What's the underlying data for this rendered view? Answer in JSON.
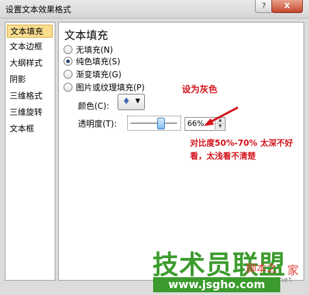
{
  "window": {
    "title": "设置文本效果格式",
    "help_label": "?",
    "close_label": "X"
  },
  "sidebar": {
    "items": [
      {
        "label": "文本填充"
      },
      {
        "label": "文本边框"
      },
      {
        "label": "大纲样式"
      },
      {
        "label": "阴影"
      },
      {
        "label": "三维格式"
      },
      {
        "label": "三维旋转"
      },
      {
        "label": "文本框"
      }
    ]
  },
  "panel": {
    "heading": "文本填充",
    "options": [
      {
        "label": "无填充(N)",
        "checked": false
      },
      {
        "label": "纯色填充(S)",
        "checked": true
      },
      {
        "label": "渐变填充(G)",
        "checked": false
      },
      {
        "label": "图片或纹理填充(P)",
        "checked": false
      }
    ],
    "color_label": "颜色(C):",
    "color_icon": "paint-bucket-icon",
    "transparency_label": "透明度(T):",
    "transparency_value": "66%",
    "transparency_fraction": 0.66
  },
  "annotations": {
    "note1": "设为灰色",
    "note2": "对比度50%-70% 太深不好看，太浅看不清楚",
    "accent_color": "#d4141d"
  },
  "watermark": {
    "main": "技术员联盟",
    "url": "www.jsgho.com",
    "sub": "脚本之",
    "net": "net",
    "jia": "家"
  }
}
